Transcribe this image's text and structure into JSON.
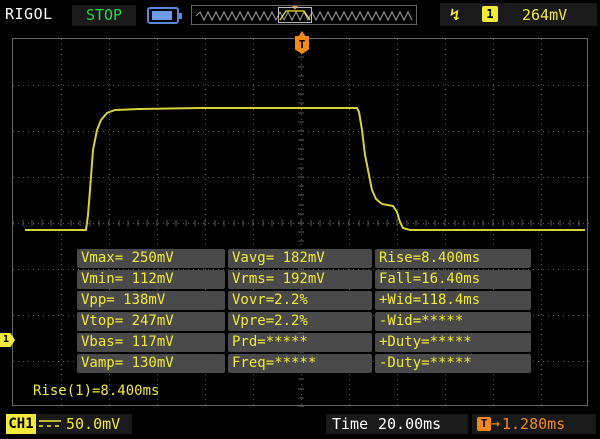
{
  "header": {
    "brand": "RIGOL",
    "run_status": "STOP",
    "trigger": {
      "edge_icon": "rising-edge-icon",
      "source": "1",
      "level": "264mV"
    }
  },
  "markers": {
    "trigger_position": "T",
    "channel_ground": "1"
  },
  "measurements": [
    [
      "Vmax= 250mV",
      "Vavg= 182mV",
      "Rise=8.400ms"
    ],
    [
      "Vmin= 112mV",
      "Vrms= 192mV",
      "Fall=16.40ms"
    ],
    [
      "Vpp= 138mV",
      "Vovr=2.2%",
      "+Wid=118.4ms"
    ],
    [
      "Vtop= 247mV",
      "Vpre=2.2%",
      "-Wid=*****"
    ],
    [
      "Vbas= 117mV",
      "Prd=*****",
      "+Duty=*****"
    ],
    [
      "Vamp= 130mV",
      "Freq=*****",
      "-Duty=*****"
    ]
  ],
  "cursor_readout": "Rise(1)=8.400ms",
  "footer": {
    "channel": "CH1",
    "channel_scale": "50.0mV",
    "time_label": "Time",
    "time_base": "20.00ms",
    "trigger_offset_icon": "T",
    "trigger_offset": "1.280ms"
  },
  "colors": {
    "channel1": "#f2ea3a",
    "trigger": "#f28a1a",
    "run_status": "#29d64c",
    "grid": "#5a5a5a"
  }
}
